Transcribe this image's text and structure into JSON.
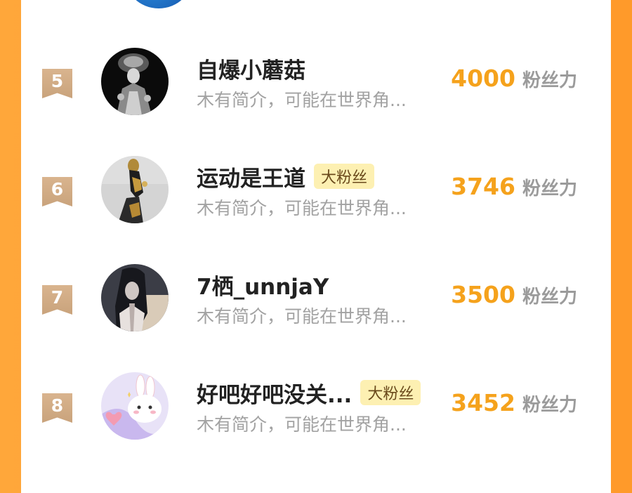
{
  "rows": [
    {
      "rank": "5",
      "name": "自爆小蘑菇",
      "tag": "",
      "bio": "木有简介，可能在世界角...",
      "score": "4000",
      "unit": "粉丝力",
      "avatar_icon": "dark-costume-portrait"
    },
    {
      "rank": "6",
      "name": "运动是王道",
      "tag": "大粉丝",
      "bio": "木有简介，可能在世界角...",
      "score": "3746",
      "unit": "粉丝力",
      "avatar_icon": "golden-figure-portrait"
    },
    {
      "rank": "7",
      "name": "7栖_unnjaY",
      "tag": "",
      "bio": "木有简介，可能在世界角...",
      "score": "3500",
      "unit": "粉丝力",
      "avatar_icon": "long-hair-portrait"
    },
    {
      "rank": "8",
      "name": "好吧好吧没关...",
      "tag": "大粉丝",
      "bio": "木有简介，可能在世界角...",
      "score": "3452",
      "unit": "粉丝力",
      "avatar_icon": "bunny-cartoon"
    }
  ],
  "colors": {
    "accent": "#f5a21c",
    "rank_badge": "#d4ae86",
    "tag_bg": "#fdf0b2",
    "frame": "#ffa73a"
  }
}
